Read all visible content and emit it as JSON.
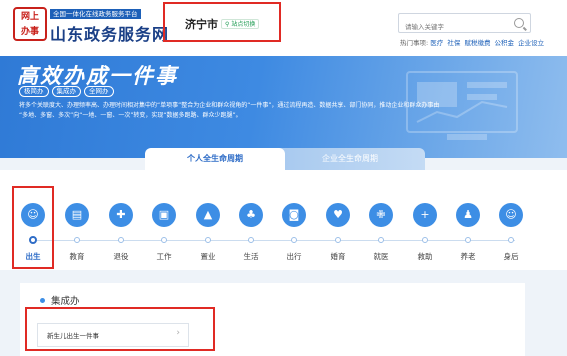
{
  "header": {
    "logo_seal": "网上\n办事",
    "platform_tag": "全国一体化在线政务服务平台",
    "site_title": "山东政务服务网",
    "city": "济宁市",
    "city_switch": "站点切换",
    "search_placeholder": "请输入关键字",
    "hot_label": "热门事项:",
    "hot_links": [
      "医疗",
      "社保",
      "赋税缴费",
      "公积金",
      "企业设立"
    ]
  },
  "banner": {
    "title": "高效办成一件事",
    "pills": [
      "极简办",
      "集成办",
      "全网办"
    ],
    "description_line1": "将多个关联度大、办理频率高、办理时间相对集中的“单项事”整合为企业和群众视角的“一件事”，通过流程再造、数据共享、部门协同，推动企业和群众办事由",
    "description_line2": "“多地、多窗、多次”向“一地、一窗、一次”转变，实现“数据多跑路、群众少跑腿”。"
  },
  "tabs": [
    {
      "label": "个人全生命周期",
      "active": true
    },
    {
      "label": "企业全生命周期",
      "active": false
    }
  ],
  "stages": [
    {
      "label": "出生",
      "icon": "baby-icon",
      "active": true
    },
    {
      "label": "教育",
      "icon": "book-icon",
      "active": false
    },
    {
      "label": "退役",
      "icon": "shield-icon",
      "active": false
    },
    {
      "label": "工作",
      "icon": "briefcase-icon",
      "active": false
    },
    {
      "label": "置业",
      "icon": "building-icon",
      "active": false
    },
    {
      "label": "生活",
      "icon": "plant-icon",
      "active": false
    },
    {
      "label": "出行",
      "icon": "car-icon",
      "active": false
    },
    {
      "label": "婚育",
      "icon": "heart-icon",
      "active": false
    },
    {
      "label": "就医",
      "icon": "medical-icon",
      "active": false
    },
    {
      "label": "救助",
      "icon": "plus-icon",
      "active": false
    },
    {
      "label": "养老",
      "icon": "elder-icon",
      "active": false
    },
    {
      "label": "身后",
      "icon": "memorial-icon",
      "active": false
    }
  ],
  "section": {
    "group_title": "集成办",
    "items": [
      {
        "label": "新生儿出生一件事"
      }
    ]
  },
  "colors": {
    "brand_blue": "#2f6dc7",
    "icon_blue": "#3d8ee5",
    "highlight_red": "#e02a24",
    "seal_red": "#c8211b"
  }
}
